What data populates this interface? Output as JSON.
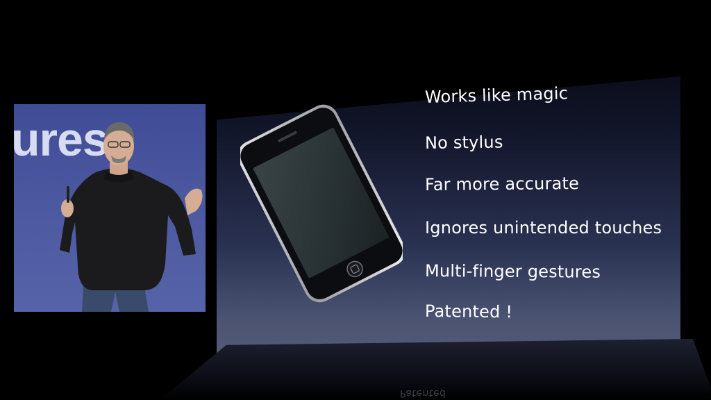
{
  "slide": {
    "features": [
      "Works like magic",
      "No stylus",
      "Far more accurate",
      "Ignores unintended touches",
      "Multi-finger gestures",
      "Patented !"
    ]
  },
  "camera_inset": {
    "backdrop_text": "ures"
  },
  "colors": {
    "background": "#000000",
    "slide_top": "#0b0d1a",
    "slide_bottom": "#5a6079",
    "stage_backdrop": "#4a579f",
    "text": "#ffffff"
  }
}
